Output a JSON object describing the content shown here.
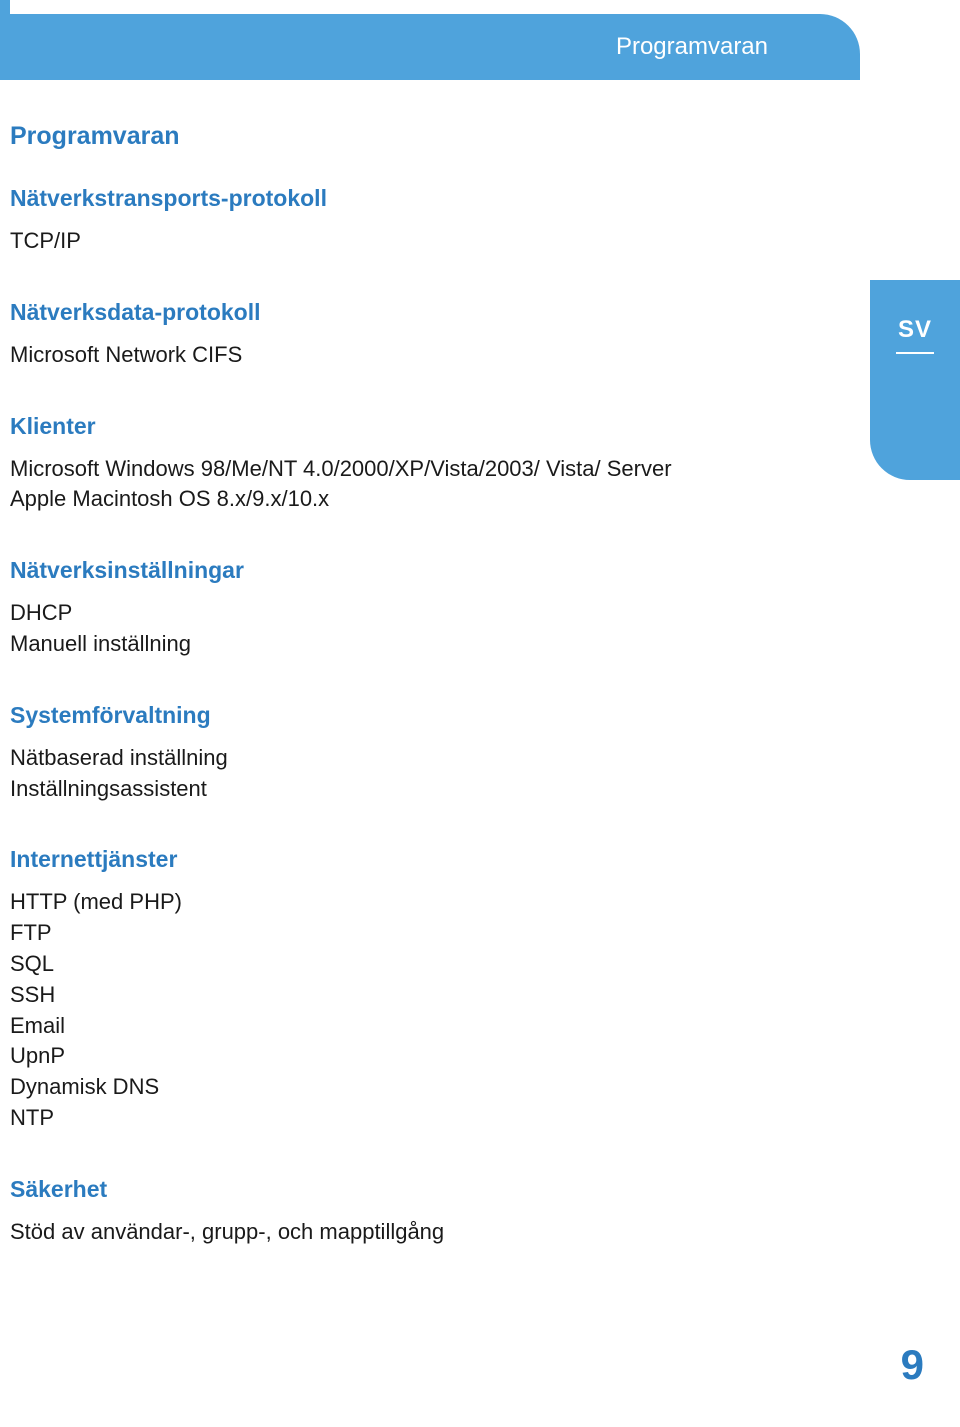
{
  "header": {
    "tab_title": "Programvaran"
  },
  "sidebar": {
    "lang": "SV"
  },
  "content": {
    "title": "Programvaran",
    "sections": [
      {
        "heading": "Nätverkstransports-protokoll",
        "lines": [
          "TCP/IP"
        ]
      },
      {
        "heading": "Nätverksdata-protokoll",
        "lines": [
          "Microsoft Network CIFS"
        ]
      },
      {
        "heading": "Klienter",
        "lines": [
          "Microsoft Windows 98/Me/NT 4.0/2000/XP/Vista/2003/ Vista/ Server",
          "Apple Macintosh OS 8.x/9.x/10.x"
        ]
      },
      {
        "heading": "Nätverksinställningar",
        "lines": [
          "DHCP",
          "Manuell inställning"
        ]
      },
      {
        "heading": "Systemförvaltning",
        "lines": [
          "Nätbaserad inställning",
          "Inställningsassistent"
        ]
      },
      {
        "heading": "Internettjänster",
        "lines": [
          "HTTP (med PHP)",
          "FTP",
          "SQL",
          "SSH",
          "Email",
          "UpnP",
          "Dynamisk DNS",
          "NTP"
        ]
      },
      {
        "heading": "Säkerhet",
        "lines": [
          "Stöd av användar-, grupp-, och mapptillgång"
        ]
      }
    ]
  },
  "page_number": "9"
}
